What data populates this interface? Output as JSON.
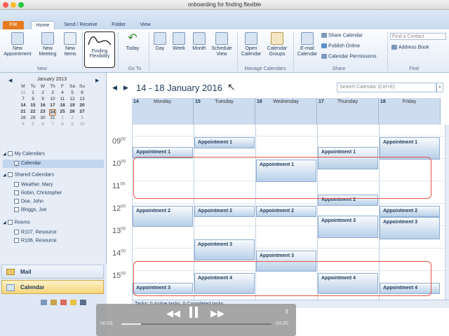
{
  "window": {
    "title": "onboarding for finding flexible"
  },
  "ribbon_tabs": [
    {
      "label": "File"
    },
    {
      "label": "Home"
    },
    {
      "label": "Send / Receive"
    },
    {
      "label": "Folder"
    },
    {
      "label": "View"
    }
  ],
  "ribbon": {
    "new_appointment": "New Appointment",
    "new_meeting": "New Meeting",
    "new_items": "New Items",
    "group_new": "New",
    "finding_flexibility_line1": "Finding",
    "finding_flexibility_line2": "Flexibility",
    "today": "Today",
    "group_goto": "Go To",
    "day": "Day",
    "week": "Week",
    "month": "Month",
    "schedule_view": "Schedule View",
    "open_calendar": "Open Calendar",
    "calendar_groups": "Calendar Groups",
    "group_manage": "Manage Calendars",
    "email_calendar": "E-mail Calendar",
    "share_calendar": "Share Calendar",
    "publish_online": "Publish Online",
    "calendar_permissions": "Calendar Permissions",
    "group_share": "Share",
    "find_contact_placeholder": "Find a Contact",
    "address_book": "Address Book",
    "group_find": "Find"
  },
  "mini_calendar": {
    "month_label": "January 2013",
    "weekday_headers": [
      "M",
      "Tu",
      "W",
      "Th",
      "F",
      "Sa",
      "Su"
    ],
    "rows": [
      [
        "31",
        "1",
        "2",
        "3",
        "4",
        "5",
        "6"
      ],
      [
        "7",
        "8",
        "9",
        "10",
        "11",
        "12",
        "13"
      ],
      [
        "14",
        "15",
        "16",
        "17",
        "18",
        "19",
        "20"
      ],
      [
        "21",
        "22",
        "23",
        "24",
        "25",
        "26",
        "27"
      ],
      [
        "28",
        "29",
        "30",
        "31",
        "1",
        "2",
        "3"
      ],
      [
        "4",
        "5",
        "6",
        "7",
        "8",
        "9",
        "10"
      ]
    ]
  },
  "folders": {
    "my_calendars": "My Calendars",
    "calendar": "Calendar",
    "shared_calendars": "Shared Calendars",
    "shared": [
      "Weather, Mary",
      "Robin, Christopher",
      "Doe, John",
      "Bloggs, Joe"
    ],
    "rooms": "Rooms",
    "room_list": [
      "R107, Resource",
      "R106, Resource"
    ]
  },
  "nav": {
    "mail": "Mail",
    "calendar": "Calendar"
  },
  "calendar": {
    "date_range": "14 - 18 January 2016",
    "search_placeholder": "Search Calendar (Ctrl+E)",
    "days": [
      {
        "num": "14",
        "name": "Monday"
      },
      {
        "num": "15",
        "name": "Tuesday"
      },
      {
        "num": "16",
        "name": "Wednesday"
      },
      {
        "num": "17",
        "name": "Thursday"
      },
      {
        "num": "18",
        "name": "Friday"
      }
    ],
    "hours": [
      {
        "h": "09",
        "m": "00"
      },
      {
        "h": "10",
        "m": "00"
      },
      {
        "h": "11",
        "m": "00"
      },
      {
        "h": "12",
        "m": "00"
      },
      {
        "h": "13",
        "m": "00"
      },
      {
        "h": "14",
        "m": "00"
      },
      {
        "h": "15",
        "m": "00"
      }
    ],
    "appointments": {
      "a1": "Appointment 1",
      "a2": "Appointment 2",
      "a3": "Appointment 3",
      "a4": "Appointment 4"
    },
    "tasks_status": "Tasks: 0 Active tasks, 0 Completed tasks"
  },
  "player": {
    "elapsed": "00:03",
    "remaining": "-00:20"
  },
  "colors": {
    "file_tab": "#e57b1e",
    "highlight": "#e05545",
    "header": "#cddcee"
  }
}
